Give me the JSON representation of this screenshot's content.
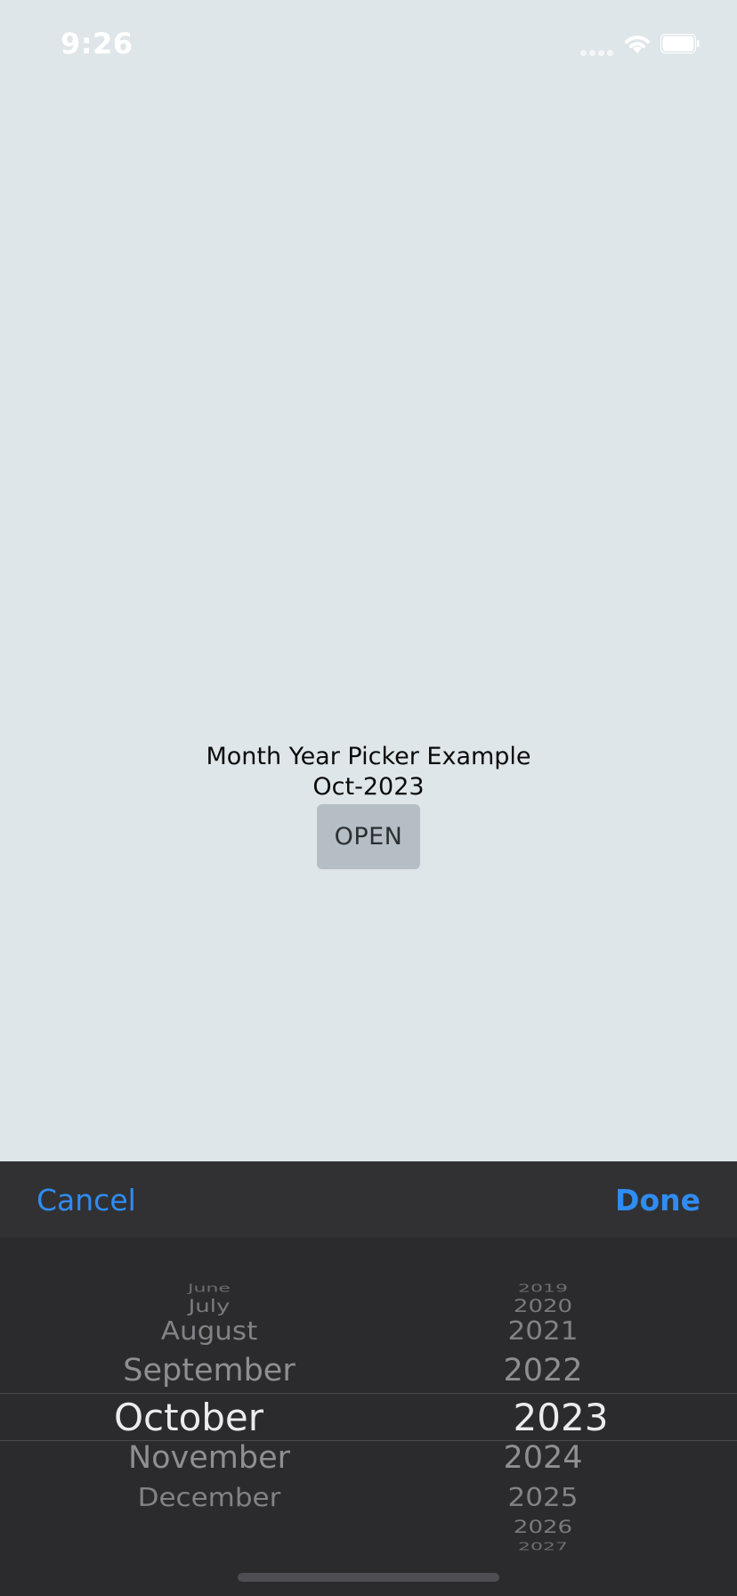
{
  "status_bar": {
    "time": "9:26"
  },
  "main": {
    "title": "Month Year Picker Example",
    "selected_value": "Oct-2023",
    "open_button_label": "OPEN"
  },
  "picker_sheet": {
    "cancel_label": "Cancel",
    "done_label": "Done",
    "months": [
      "June",
      "July",
      "August",
      "September",
      "October",
      "November",
      "December"
    ],
    "selected_month": "October",
    "years": [
      "2019",
      "2020",
      "2021",
      "2022",
      "2023",
      "2024",
      "2025",
      "2026",
      "2027"
    ],
    "selected_year": "2023"
  },
  "colors": {
    "background": "#dfe6ea",
    "sheet": "#2b2b2d",
    "accent": "#2f8cf2",
    "button": "#b4bec4"
  }
}
